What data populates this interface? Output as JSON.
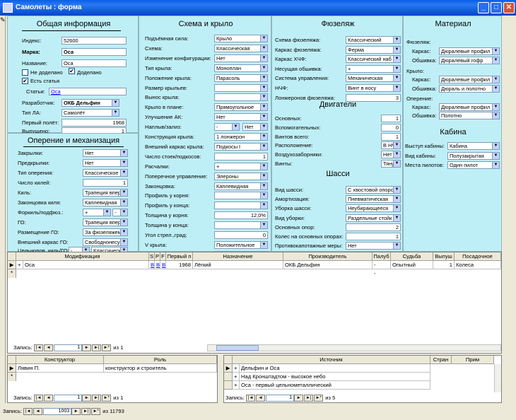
{
  "window": {
    "title": "Самолеты : форма",
    "min": "_",
    "max": "□",
    "close": "✕"
  },
  "general": {
    "heading": "Общая информация",
    "index_label": "Индекс:",
    "index": "52600",
    "brand_label": "Марка:",
    "brand": "Оса",
    "name_label": "Название:",
    "name": "Оса",
    "not_done_label": "Не доделано",
    "done_label": "Доделано",
    "has_article_label": "Есть статья",
    "articles_label": "Статьи:",
    "articles": "Оса",
    "developer_label": "Разработчик:",
    "developer": "ОКБ Дельфин",
    "type_label": "Тип ЛА:",
    "type": "Самолёт",
    "first_flight_label": "Первый полёт:",
    "first_flight": "1968",
    "produced_label": "Выпущено:",
    "produced": "1"
  },
  "plumage": {
    "heading": "Оперение и механизация",
    "rows": [
      {
        "label": "Закрылки:",
        "value": "Нет"
      },
      {
        "label": "Предкрылки:",
        "value": "Нет"
      },
      {
        "label": "Тип оперения:",
        "value": "Классическое"
      },
      {
        "label": "Число килей:",
        "value": "1"
      },
      {
        "label": "Киль:",
        "value": "Трапеция вперёд"
      },
      {
        "label": "Законцовка киля:",
        "value": "Каплевидная"
      },
      {
        "label": "Форкиль/подфюз.:",
        "value": "+",
        "value2": "-"
      },
      {
        "label": "ГО:",
        "value": "Трапеция вперёд"
      },
      {
        "label": "Размещение ГО:",
        "value": "За фюзеляжем"
      },
      {
        "label": "Внешний каркас ГО:",
        "value": "Свободнонесущее"
      },
      {
        "label": "Цельнопов. киль/ГО:",
        "value": "-",
        "value2": "Классическое"
      }
    ]
  },
  "wing": {
    "heading": "Схема и крыло",
    "rows": [
      {
        "label": "Подъёмная сила:",
        "value": "Крыло"
      },
      {
        "label": "Схема:",
        "value": "Классическая"
      },
      {
        "label": "Изменение конфигурации:",
        "value": "Нет"
      },
      {
        "label": "Тип крыла:",
        "value": "Моноплан"
      },
      {
        "label": "Положение крыла:",
        "value": "Парасоль"
      },
      {
        "label": "Размер крыльев:",
        "value": ""
      },
      {
        "label": "Вынос крыла:",
        "value": ""
      },
      {
        "label": "Крыло в плане:",
        "value": "Прямоугольное"
      },
      {
        "label": "Улучшение АК:",
        "value": "Нет"
      },
      {
        "label": "Наплыв/зализ:",
        "value": "-",
        "value2": "Нет"
      },
      {
        "label": "Конструкция крыла:",
        "value": "1 лонжерон"
      },
      {
        "label": "Внешний каркас крыла:",
        "value": "Подкосы I"
      },
      {
        "label": "Число стоек/подкосов:",
        "value": "1"
      },
      {
        "label": "Расчалки:",
        "value": "+"
      },
      {
        "label": "Поперечное управление:",
        "value": "Элероны"
      },
      {
        "label": "Законцовка:",
        "value": "Каплевидная"
      },
      {
        "label": "Профиль у корня:",
        "value": ""
      },
      {
        "label": "Профиль у конца:",
        "value": ""
      },
      {
        "label": "Толщина у корня:",
        "value": "12,0%"
      },
      {
        "label": "Толщина у конца:",
        "value": ""
      },
      {
        "label": "Угол стрел.,град:",
        "value": "0"
      },
      {
        "label": "V крыла:",
        "value": "Положительное"
      },
      {
        "label": "Угол V:",
        "value": "1,0"
      }
    ]
  },
  "fuselage": {
    "heading": "Фюзеляж",
    "rows": [
      {
        "label": "Схема фюзеляжа:",
        "value": "Классический"
      },
      {
        "label": "Каркас фюзеляжа:",
        "value": "Ферма"
      },
      {
        "label": "Каркас ХЧФ:",
        "value": "Классический наб"
      },
      {
        "label": "Несущая обшивка:",
        "value": "+"
      },
      {
        "label": "Система управления:",
        "value": "Механическая"
      },
      {
        "label": "НЧФ:",
        "value": "Винт в носу"
      },
      {
        "label": "Лонжеронов фюзеляжа:",
        "value": "3"
      }
    ]
  },
  "engines": {
    "heading": "Двигатели",
    "rows": [
      {
        "label": "Основных:",
        "value": "1"
      },
      {
        "label": "Вспомогательных:",
        "value": "0"
      },
      {
        "label": "Винтов всего:",
        "value": "1"
      },
      {
        "label": "Расположение:",
        "value": "В НЧФ"
      },
      {
        "label": "Воздухозаборники:",
        "value": "Нет"
      },
      {
        "label": "Винты:",
        "value": "Тянущие"
      }
    ]
  },
  "gear": {
    "heading": "Шасси",
    "rows": [
      {
        "label": "Вид шасси:",
        "value": "С хвостовой опорс"
      },
      {
        "label": "Амортизация:",
        "value": "Пневматическая"
      },
      {
        "label": "Уборка шасси:",
        "value": "Неубирающееся"
      },
      {
        "label": "Вид уборки:",
        "value": "Раздельные стойк"
      },
      {
        "label": "Основных опор:",
        "value": "2"
      },
      {
        "label": "Колес на основных опорах:",
        "value": "1"
      },
      {
        "label": "Противокапотажные меры:",
        "value": "Нет"
      }
    ]
  },
  "material": {
    "heading": "Материал",
    "fuselage_label": "Фюзеляж:",
    "wing_label": "Крыло:",
    "plumage_label": "Оперение:",
    "frame_label": "Каркас:",
    "skin_label": "Обшивка:",
    "fus_frame": "Дюралевые профил",
    "fus_skin": "Дюралевый гофр",
    "wing_frame": "Дюралевые профил",
    "wing_skin": "Дюраль и полотно",
    "plm_frame": "Дюралевые профил",
    "plm_skin": "Полотно"
  },
  "cabin": {
    "heading": "Кабина",
    "rows": [
      {
        "label": "Выступ кабины:",
        "value": "Кабина"
      },
      {
        "label": "Вид кабины:",
        "value": "Полузакрытая"
      },
      {
        "label": "Места пилотов:",
        "value": "Один пилот"
      }
    ]
  },
  "mods": {
    "headers": [
      "Модификация",
      "S",
      "P",
      "F",
      "Первый п",
      "Назначение",
      "Производитель",
      "Палуб",
      "Судьба",
      "Выпуш",
      "Посадочное"
    ],
    "row": [
      "Оса",
      "B",
      "B",
      "B",
      "1968",
      "Лёгкий",
      "ОКБ Дельфин",
      "-",
      "Опытный",
      "1",
      "Колеса"
    ],
    "nav_label": "Запись:",
    "nav_pos": "1",
    "nav_of": "из 1"
  },
  "designers": {
    "headers": [
      "Конструктор",
      "Роль"
    ],
    "row": [
      "Лявин П.",
      "конструктор и строитель"
    ],
    "nav_label": "Запись:",
    "nav_pos": "1",
    "nav_of": "из 1"
  },
  "sources": {
    "headers": [
      "Источник",
      "Стран",
      "Прим"
    ],
    "rows": [
      "Дельфин и Оса",
      "Над Кронштадтом - высокое небо",
      "Оса - первый цельнометаллический"
    ],
    "nav_label": "Запись:",
    "nav_pos": "1",
    "nav_of": "из 5"
  },
  "main_nav": {
    "label": "Запись:",
    "pos": "1003",
    "of": "из 11793"
  },
  "nav_icons": {
    "first": "|◄",
    "prev": "◄",
    "next": "►",
    "last": "►|",
    "new": "►*"
  }
}
